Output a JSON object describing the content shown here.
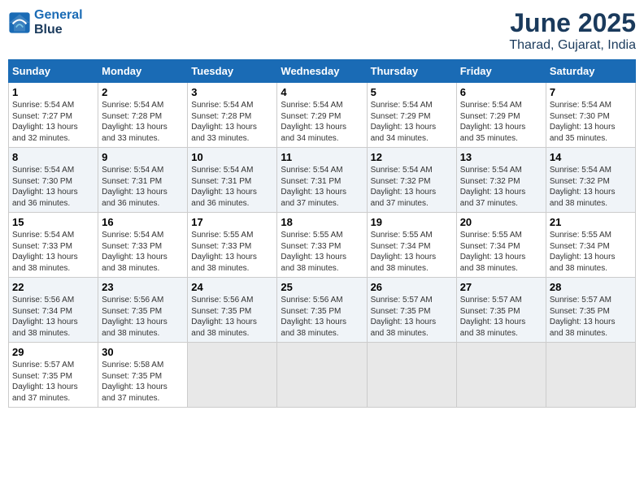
{
  "logo": {
    "line1": "General",
    "line2": "Blue"
  },
  "title": "June 2025",
  "location": "Tharad, Gujarat, India",
  "headers": [
    "Sunday",
    "Monday",
    "Tuesday",
    "Wednesday",
    "Thursday",
    "Friday",
    "Saturday"
  ],
  "weeks": [
    [
      {
        "day": "1",
        "info": "Sunrise: 5:54 AM\nSunset: 7:27 PM\nDaylight: 13 hours\nand 32 minutes."
      },
      {
        "day": "2",
        "info": "Sunrise: 5:54 AM\nSunset: 7:28 PM\nDaylight: 13 hours\nand 33 minutes."
      },
      {
        "day": "3",
        "info": "Sunrise: 5:54 AM\nSunset: 7:28 PM\nDaylight: 13 hours\nand 33 minutes."
      },
      {
        "day": "4",
        "info": "Sunrise: 5:54 AM\nSunset: 7:29 PM\nDaylight: 13 hours\nand 34 minutes."
      },
      {
        "day": "5",
        "info": "Sunrise: 5:54 AM\nSunset: 7:29 PM\nDaylight: 13 hours\nand 34 minutes."
      },
      {
        "day": "6",
        "info": "Sunrise: 5:54 AM\nSunset: 7:29 PM\nDaylight: 13 hours\nand 35 minutes."
      },
      {
        "day": "7",
        "info": "Sunrise: 5:54 AM\nSunset: 7:30 PM\nDaylight: 13 hours\nand 35 minutes."
      }
    ],
    [
      {
        "day": "8",
        "info": "Sunrise: 5:54 AM\nSunset: 7:30 PM\nDaylight: 13 hours\nand 36 minutes."
      },
      {
        "day": "9",
        "info": "Sunrise: 5:54 AM\nSunset: 7:31 PM\nDaylight: 13 hours\nand 36 minutes."
      },
      {
        "day": "10",
        "info": "Sunrise: 5:54 AM\nSunset: 7:31 PM\nDaylight: 13 hours\nand 36 minutes."
      },
      {
        "day": "11",
        "info": "Sunrise: 5:54 AM\nSunset: 7:31 PM\nDaylight: 13 hours\nand 37 minutes."
      },
      {
        "day": "12",
        "info": "Sunrise: 5:54 AM\nSunset: 7:32 PM\nDaylight: 13 hours\nand 37 minutes."
      },
      {
        "day": "13",
        "info": "Sunrise: 5:54 AM\nSunset: 7:32 PM\nDaylight: 13 hours\nand 37 minutes."
      },
      {
        "day": "14",
        "info": "Sunrise: 5:54 AM\nSunset: 7:32 PM\nDaylight: 13 hours\nand 38 minutes."
      }
    ],
    [
      {
        "day": "15",
        "info": "Sunrise: 5:54 AM\nSunset: 7:33 PM\nDaylight: 13 hours\nand 38 minutes."
      },
      {
        "day": "16",
        "info": "Sunrise: 5:54 AM\nSunset: 7:33 PM\nDaylight: 13 hours\nand 38 minutes."
      },
      {
        "day": "17",
        "info": "Sunrise: 5:55 AM\nSunset: 7:33 PM\nDaylight: 13 hours\nand 38 minutes."
      },
      {
        "day": "18",
        "info": "Sunrise: 5:55 AM\nSunset: 7:33 PM\nDaylight: 13 hours\nand 38 minutes."
      },
      {
        "day": "19",
        "info": "Sunrise: 5:55 AM\nSunset: 7:34 PM\nDaylight: 13 hours\nand 38 minutes."
      },
      {
        "day": "20",
        "info": "Sunrise: 5:55 AM\nSunset: 7:34 PM\nDaylight: 13 hours\nand 38 minutes."
      },
      {
        "day": "21",
        "info": "Sunrise: 5:55 AM\nSunset: 7:34 PM\nDaylight: 13 hours\nand 38 minutes."
      }
    ],
    [
      {
        "day": "22",
        "info": "Sunrise: 5:56 AM\nSunset: 7:34 PM\nDaylight: 13 hours\nand 38 minutes."
      },
      {
        "day": "23",
        "info": "Sunrise: 5:56 AM\nSunset: 7:35 PM\nDaylight: 13 hours\nand 38 minutes."
      },
      {
        "day": "24",
        "info": "Sunrise: 5:56 AM\nSunset: 7:35 PM\nDaylight: 13 hours\nand 38 minutes."
      },
      {
        "day": "25",
        "info": "Sunrise: 5:56 AM\nSunset: 7:35 PM\nDaylight: 13 hours\nand 38 minutes."
      },
      {
        "day": "26",
        "info": "Sunrise: 5:57 AM\nSunset: 7:35 PM\nDaylight: 13 hours\nand 38 minutes."
      },
      {
        "day": "27",
        "info": "Sunrise: 5:57 AM\nSunset: 7:35 PM\nDaylight: 13 hours\nand 38 minutes."
      },
      {
        "day": "28",
        "info": "Sunrise: 5:57 AM\nSunset: 7:35 PM\nDaylight: 13 hours\nand 38 minutes."
      }
    ],
    [
      {
        "day": "29",
        "info": "Sunrise: 5:57 AM\nSunset: 7:35 PM\nDaylight: 13 hours\nand 37 minutes."
      },
      {
        "day": "30",
        "info": "Sunrise: 5:58 AM\nSunset: 7:35 PM\nDaylight: 13 hours\nand 37 minutes."
      },
      {
        "day": "",
        "info": ""
      },
      {
        "day": "",
        "info": ""
      },
      {
        "day": "",
        "info": ""
      },
      {
        "day": "",
        "info": ""
      },
      {
        "day": "",
        "info": ""
      }
    ]
  ]
}
